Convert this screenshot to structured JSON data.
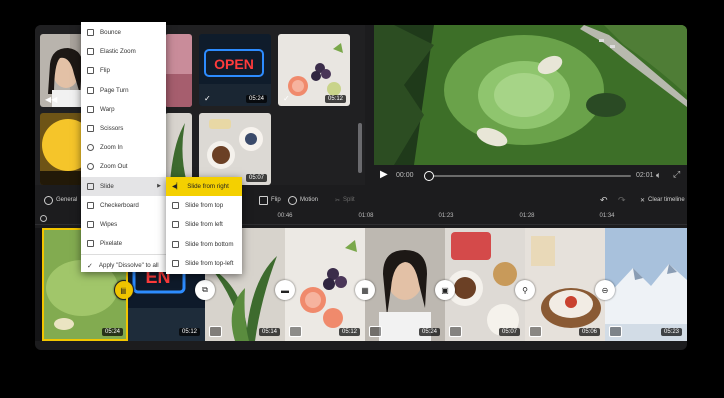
{
  "library": {
    "durations": [
      "05:24",
      "05:12",
      "05:12",
      "05:07"
    ]
  },
  "preview": {
    "time_current": "00:00",
    "time_total": "02:01",
    "play_icon": "play-icon",
    "volume_icon": "volume-icon",
    "fullscreen_icon": "fullscreen-icon"
  },
  "toolbar": {
    "items": [
      {
        "label": "General",
        "icon": "general-icon"
      },
      {
        "label": "Flip",
        "icon": "flip-icon"
      },
      {
        "label": "Motion",
        "icon": "motion-icon"
      },
      {
        "label": "Split",
        "icon": "split-icon"
      }
    ],
    "clear_timeline": "Clear timeline"
  },
  "ruler": {
    "ticks": [
      "00:46",
      "01:08",
      "01:23",
      "01:28",
      "01:34"
    ]
  },
  "timeline": {
    "clips": [
      {
        "duration": "05:24"
      },
      {
        "duration": "05:12"
      },
      {
        "duration": "05:14"
      },
      {
        "duration": "05:12"
      },
      {
        "duration": "05:24"
      },
      {
        "duration": "05:07"
      },
      {
        "duration": "05:06"
      },
      {
        "duration": "05:23"
      }
    ]
  },
  "transition_menu": {
    "items": [
      {
        "label": "Bounce",
        "icon": "bounce-icon"
      },
      {
        "label": "Elastic Zoom",
        "icon": "elastic-zoom-icon"
      },
      {
        "label": "Flip",
        "icon": "flip-icon"
      },
      {
        "label": "Page Turn",
        "icon": "page-turn-icon"
      },
      {
        "label": "Warp",
        "icon": "warp-icon"
      },
      {
        "label": "Scissors",
        "icon": "scissors-icon"
      },
      {
        "label": "Zoom In",
        "icon": "zoom-in-icon"
      },
      {
        "label": "Zoom Out",
        "icon": "zoom-out-icon"
      },
      {
        "label": "Slide",
        "icon": "slide-icon"
      },
      {
        "label": "Checkerboard",
        "icon": "checkerboard-icon"
      },
      {
        "label": "Wipes",
        "icon": "wipes-icon"
      },
      {
        "label": "Pixelate",
        "icon": "pixelate-icon"
      }
    ],
    "apply_all": "Apply \"Dissolve\" to all"
  },
  "slide_submenu": {
    "items": [
      {
        "label": "Slide from right",
        "active": true
      },
      {
        "label": "Slide from top",
        "active": false
      },
      {
        "label": "Slide from left",
        "active": false
      },
      {
        "label": "Slide from bottom",
        "active": false
      },
      {
        "label": "Slide from top-left",
        "active": false
      }
    ]
  },
  "colors": {
    "accent": "#f4d000",
    "panel": "#1c1c1e",
    "selection": "#f2c600"
  }
}
